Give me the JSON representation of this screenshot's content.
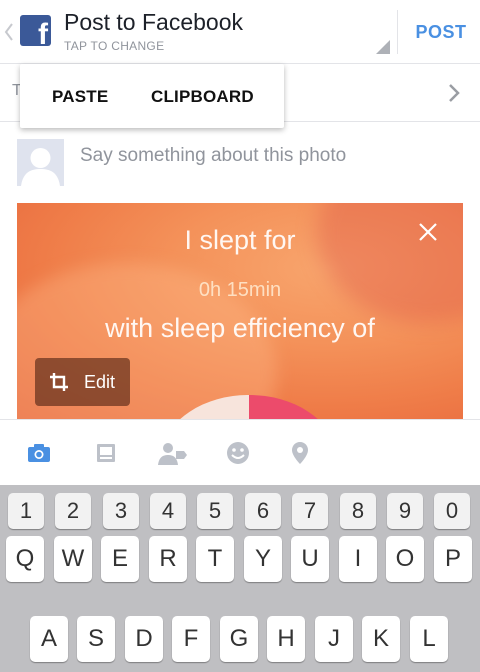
{
  "header": {
    "title": "Post to Facebook",
    "subtitle": "TAP TO CHANGE",
    "post_label": "POST",
    "brand_letter": "f"
  },
  "row2": {
    "partial_letter": "T"
  },
  "popup": {
    "paste_label": "PASTE",
    "clipboard_label": "CLIPBOARD"
  },
  "composer": {
    "placeholder": "Say something about this photo"
  },
  "photo": {
    "line1": "I slept for",
    "line2": "0h 15min",
    "line3": "with sleep efficiency of",
    "edit_label": "Edit"
  },
  "toolbar": {
    "icons": [
      "camera-icon",
      "sticker-icon",
      "tag-people-icon",
      "emoji-icon",
      "location-icon"
    ],
    "active_color": "#4a90e2",
    "inactive_color": "#bdc1c9"
  },
  "keyboard": {
    "numbers": [
      "1",
      "2",
      "3",
      "4",
      "5",
      "6",
      "7",
      "8",
      "9",
      "0"
    ],
    "row1": [
      "Q",
      "W",
      "E",
      "R",
      "T",
      "Y",
      "U",
      "I",
      "O",
      "P"
    ],
    "row2": [
      "A",
      "S",
      "D",
      "F",
      "G",
      "H",
      "J",
      "K",
      "L"
    ]
  },
  "colors": {
    "facebook_blue": "#3b5998",
    "accent": "#4a90e2",
    "keyboard_bg": "#bfbfc2"
  }
}
